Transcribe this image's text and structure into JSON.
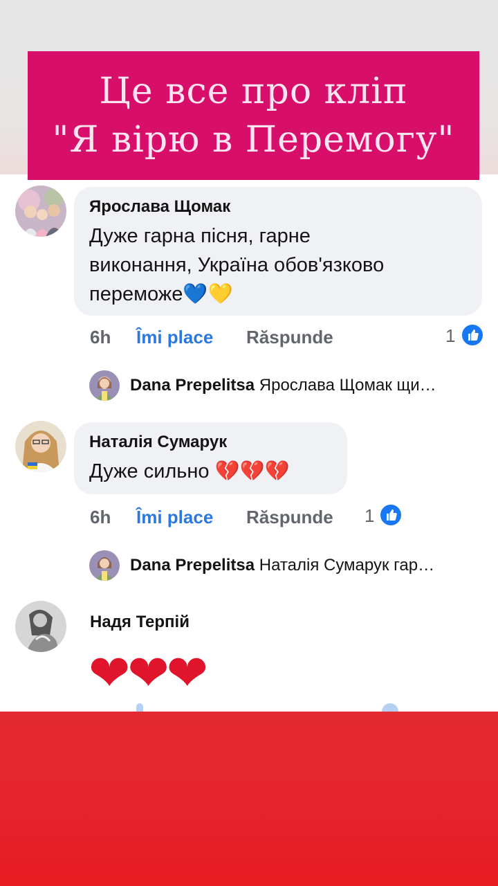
{
  "banner": {
    "line1": "Це все про кліп",
    "line2": "\"Я вірю в Перемогу\""
  },
  "comments": [
    {
      "author": "Ярослава Щомак",
      "text_line1": "Дуже гарна пісня, гарне",
      "text_line2": "виконання, Україна обов'язково",
      "text_line3": "переможе",
      "emoji": "💙💛",
      "time": "6h",
      "like_label": "Îmi place",
      "reply_label": "Răspunde",
      "likes": "1",
      "reply": {
        "author": "Dana Prepelitsa",
        "preview": "Ярослава Щомак щи…"
      }
    },
    {
      "author": "Наталія Сумарук",
      "text": "Дуже сильно ",
      "emoji": "💔💔💔",
      "time": "6h",
      "like_label": "Îmi place",
      "reply_label": "Răspunde",
      "likes": "1",
      "reply": {
        "author": "Dana Prepelitsa",
        "preview": "Наталія Сумарук гар…"
      }
    },
    {
      "author": "Надя Терпій",
      "emoji": "❤❤❤"
    }
  ],
  "colors": {
    "banner_bg": "#d80f6a",
    "link_blue": "#2d78e0",
    "bottom_red": "#e5232b"
  }
}
